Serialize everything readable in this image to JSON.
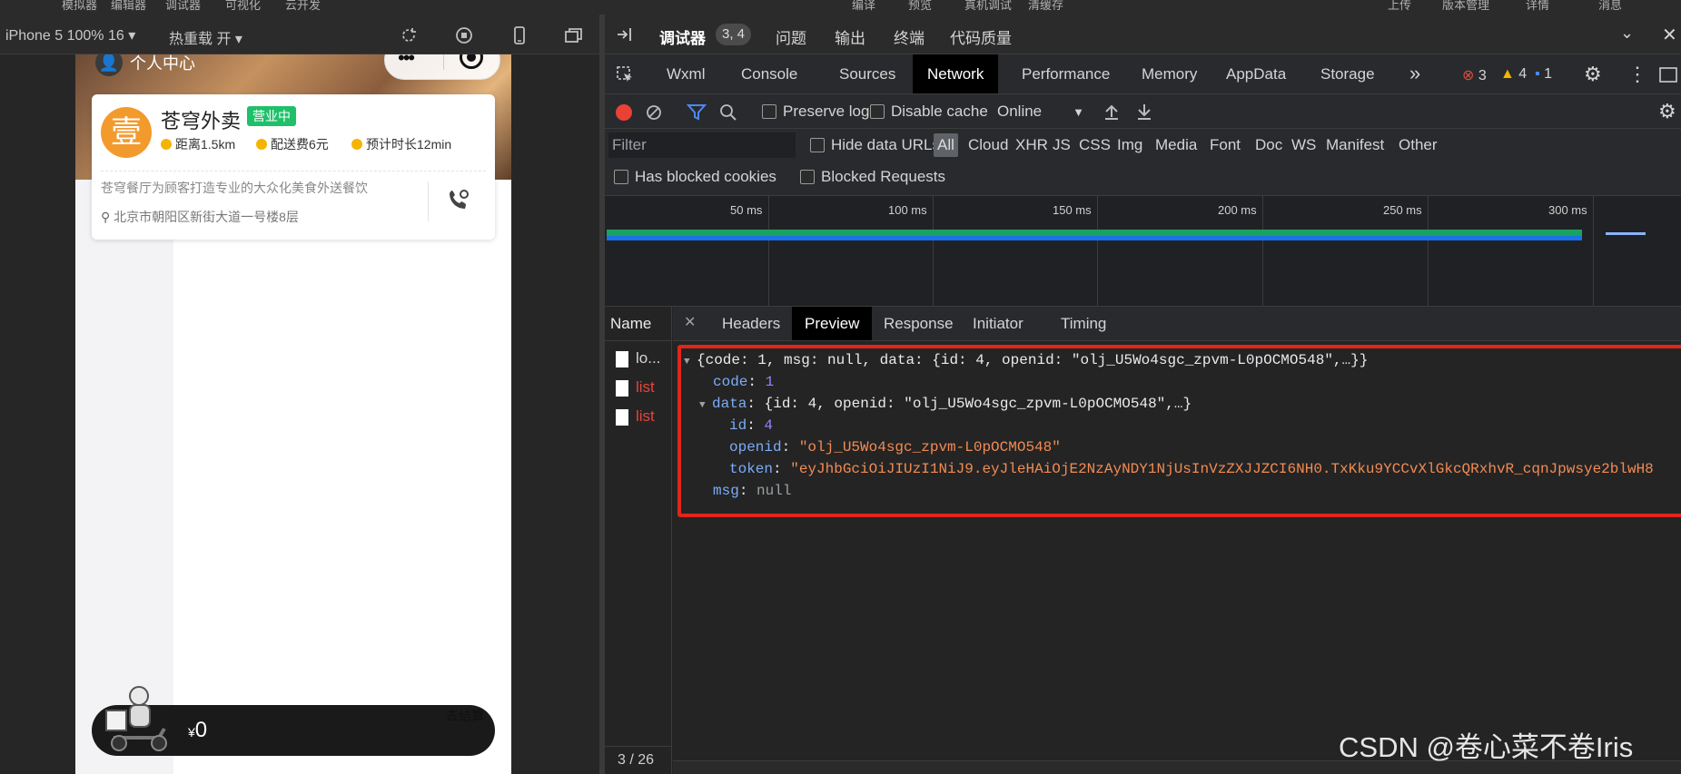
{
  "top_strip": {
    "items": [
      "模拟器",
      "编辑器",
      "调试器",
      "可视化",
      "云开发",
      "编译",
      "预览",
      "真机调试",
      "清缓存",
      "上传",
      "版本管理",
      "详情",
      "消息"
    ]
  },
  "simulator": {
    "device_label": "iPhone 5 100% 16",
    "hot_reload_label": "热重载 开",
    "phone": {
      "person_center_label": "个人中心",
      "shop": {
        "logo_char": "壹",
        "name": "苍穹外卖",
        "status": "营业中",
        "distance": "距离1.5km",
        "delivery_fee": "配送费6元",
        "eta": "预计时长12min",
        "description": "苍穹餐厅为顾客打造专业的大众化美食外送餐饮",
        "address": "北京市朝阳区新街大道一号楼8层"
      },
      "cart": {
        "currency": "¥",
        "amount": "0",
        "checkout_label": "去结算"
      }
    }
  },
  "devtools": {
    "top_tabs": {
      "debugger": "调试器",
      "badge": "3, 4",
      "issues": "问题",
      "output": "输出",
      "terminal": "终端",
      "code_quality": "代码质量"
    },
    "panel_tabs": [
      "Wxml",
      "Console",
      "Sources",
      "Network",
      "Performance",
      "Memory",
      "AppData",
      "Storage"
    ],
    "active_panel": "Network",
    "more_label": "»",
    "counters": {
      "errors": "3",
      "warnings": "4",
      "info": "1"
    },
    "network_toolbar": {
      "preserve_log": "Preserve log",
      "disable_cache": "Disable cache",
      "throttle": "Online"
    },
    "filter": {
      "placeholder": "Filter",
      "hide_data_urls": "Hide data URLs",
      "types": [
        "All",
        "Cloud",
        "XHR",
        "JS",
        "CSS",
        "Img",
        "Media",
        "Font",
        "Doc",
        "WS",
        "Manifest",
        "Other"
      ],
      "has_blocked_cookies": "Has blocked cookies",
      "blocked_requests": "Blocked Requests"
    },
    "timeline": {
      "ticks": [
        "50 ms",
        "100 ms",
        "150 ms",
        "200 ms",
        "250 ms",
        "300 ms"
      ]
    },
    "requests": {
      "header": "Name",
      "rows": [
        {
          "name": "lo...",
          "color": "#d4d4d4"
        },
        {
          "name": "list",
          "color": "#e0463c"
        },
        {
          "name": "list",
          "color": "#e0463c"
        }
      ],
      "count": "3 / 26"
    },
    "detail_tabs": [
      "Headers",
      "Preview",
      "Response",
      "Initiator",
      "Timing"
    ],
    "active_detail_tab": "Preview",
    "preview": {
      "summary": "{code: 1, msg: null, data: {id: 4, openid: \"olj_U5Wo4sgc_zpvm-L0pOCMO548\",…}}",
      "code_key": "code",
      "code_val": "1",
      "data_key": "data",
      "data_summary": "{id: 4, openid: \"olj_U5Wo4sgc_zpvm-L0pOCMO548\",…}",
      "id_key": "id",
      "id_val": "4",
      "openid_key": "openid",
      "openid_val": "\"olj_U5Wo4sgc_zpvm-L0pOCMO548\"",
      "token_key": "token",
      "token_val": "\"eyJhbGciOiJIUzI1NiJ9.eyJleHAiOjE2NzAyNDY1NjUsInVzZXJJZCI6NH0.TxKku9YCCvXlGkcQRxhvR_cqnJpwsye2blwH8",
      "msg_key": "msg",
      "msg_val": "null"
    },
    "highlight_color": "#e1251b"
  },
  "watermark": "CSDN @卷心菜不卷Iris"
}
